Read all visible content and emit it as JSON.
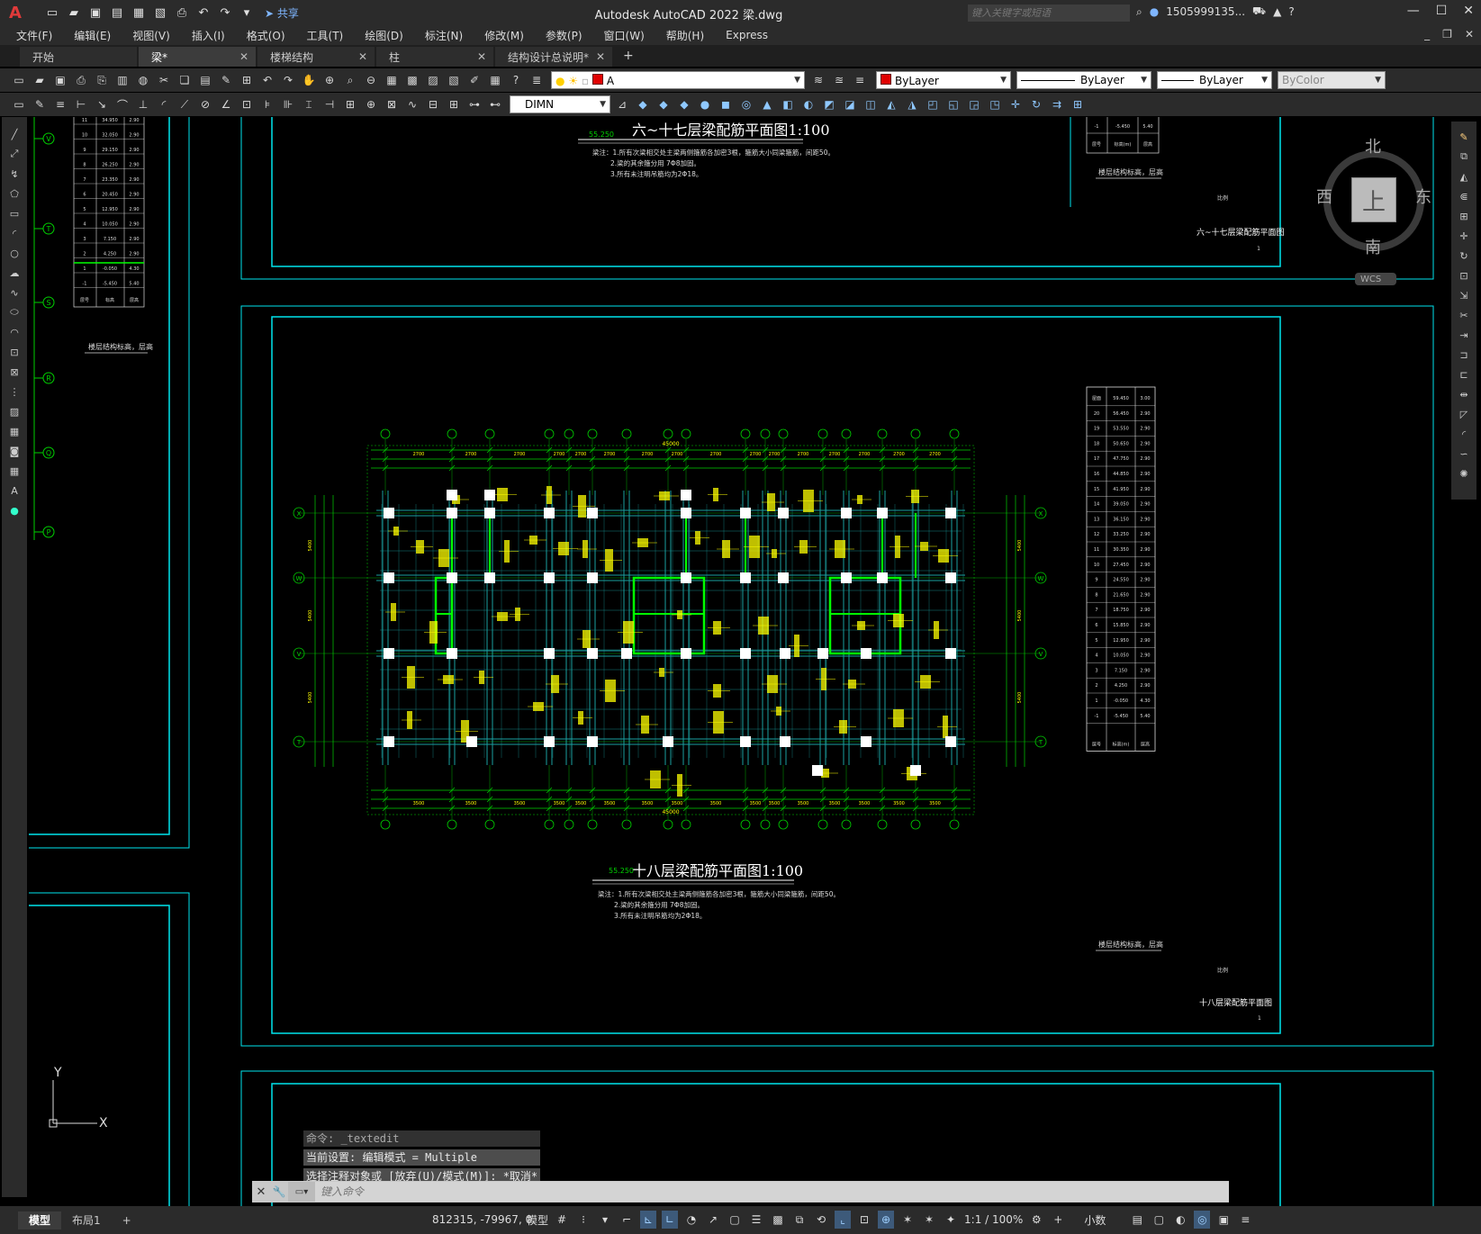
{
  "app": {
    "title": "Autodesk AutoCAD 2022    梁.dwg",
    "logo": "A",
    "share_label": "共享",
    "search_placeholder": "键入关键字或短语",
    "user": "1505999135...",
    "window_controls": [
      "—",
      "☐",
      "✕"
    ]
  },
  "menu": [
    "文件(F)",
    "编辑(E)",
    "视图(V)",
    "插入(I)",
    "格式(O)",
    "工具(T)",
    "绘图(D)",
    "标注(N)",
    "修改(M)",
    "参数(P)",
    "窗口(W)",
    "帮助(H)",
    "Express"
  ],
  "tabs": [
    {
      "label": "开始",
      "closable": false,
      "active": false
    },
    {
      "label": "梁*",
      "closable": true,
      "active": true
    },
    {
      "label": "楼梯结构",
      "closable": true,
      "active": false
    },
    {
      "label": "柱",
      "closable": true,
      "active": false
    },
    {
      "label": "结构设计总说明*",
      "closable": true,
      "active": false
    }
  ],
  "properties": {
    "layer": "A",
    "color": "ByLayer",
    "linetype": "ByLayer",
    "lineweight": "ByLayer",
    "plotstyle": "ByColor",
    "dimstyle": "DIMN",
    "layer_color": "#e00000"
  },
  "viewcube": {
    "north": "北",
    "south": "南",
    "west": "西",
    "east": "东",
    "top": "上",
    "wcs": "WCS"
  },
  "drawing": {
    "upper_title": "六~十七层梁配筋平面图1:100",
    "upper_elev": "55.250",
    "main_title": "十八层梁配筋平面图1:100",
    "main_elev": "55.250",
    "notes": [
      "梁注：1.所有次梁相交处主梁两侧箍筋各加密3根，箍筋大小同梁箍筋，间距50。",
      "2.梁的其余箍分用 7Φ8加固。",
      "3.所有未注明吊筋均为2Φ18。"
    ],
    "table_caption": "楼层结构标高，层高",
    "right_label_upper": "六~十七层梁配筋平面图",
    "right_label_main": "十八层梁配筋平面图",
    "scale_label": "比例",
    "sheet_no": "1",
    "total_dim": "45000",
    "axis_rows": [
      "X",
      "W",
      "V",
      "T"
    ],
    "left_axis_rows": [
      "V",
      "T",
      "S",
      "R",
      "Q",
      "P"
    ],
    "floor_table_header": [
      "层号",
      "标高(m)",
      "层高"
    ],
    "floor_table": [
      [
        "屋面",
        "59.450",
        "3.00"
      ],
      [
        "20",
        "56.450",
        "2.90"
      ],
      [
        "19",
        "53.550",
        "2.90"
      ],
      [
        "18",
        "50.650",
        "2.90"
      ],
      [
        "17",
        "47.750",
        "2.90"
      ],
      [
        "16",
        "44.850",
        "2.90"
      ],
      [
        "15",
        "41.950",
        "2.90"
      ],
      [
        "14",
        "39.050",
        "2.90"
      ],
      [
        "13",
        "36.150",
        "2.90"
      ],
      [
        "12",
        "33.250",
        "2.90"
      ],
      [
        "11",
        "30.350",
        "2.90"
      ],
      [
        "10",
        "27.450",
        "2.90"
      ],
      [
        "9",
        "24.550",
        "2.90"
      ],
      [
        "8",
        "21.650",
        "2.90"
      ],
      [
        "7",
        "18.750",
        "2.90"
      ],
      [
        "6",
        "15.850",
        "2.90"
      ],
      [
        "5",
        "12.950",
        "2.90"
      ],
      [
        "4",
        "10.050",
        "2.90"
      ],
      [
        "3",
        "7.150",
        "2.90"
      ],
      [
        "2",
        "4.250",
        "2.90"
      ],
      [
        "1",
        "-0.050",
        "4.30"
      ],
      [
        "-1",
        "-5.450",
        "5.40"
      ]
    ],
    "left_table": [
      [
        "11",
        "34.950",
        "2.90"
      ],
      [
        "10",
        "32.050",
        "2.90"
      ],
      [
        "9",
        "29.150",
        "2.90"
      ],
      [
        "8",
        "26.250",
        "2.90"
      ],
      [
        "7",
        "23.350",
        "2.90"
      ],
      [
        "6",
        "20.450",
        "2.90"
      ],
      [
        "5",
        "12.950",
        "2.90"
      ],
      [
        "4",
        "10.050",
        "2.90"
      ],
      [
        "3",
        "7.150",
        "2.90"
      ],
      [
        "2",
        "4.250",
        "2.90"
      ],
      [
        "1",
        "-0.050",
        "4.30"
      ],
      [
        "-1",
        "-5.450",
        "5.40"
      ]
    ],
    "left_table_footer": [
      "层号",
      "标高",
      "层高"
    ],
    "ucs": {
      "x": "X",
      "y": "Y"
    }
  },
  "command": {
    "history": [
      "命令: _textedit",
      "当前设置: 编辑模式 = Multiple",
      "选择注释对象或 [放弃(U)/模式(M)]: *取消*"
    ],
    "placeholder": "键入命令"
  },
  "status": {
    "layouts": [
      "模型",
      "布局1"
    ],
    "coords": "812315, -79967, 0",
    "model_label": "模型",
    "scale": "1:1 / 100%",
    "units": "小数"
  },
  "colors": {
    "frame": "#00e5ee",
    "axis": "#00d000",
    "beam": "#00ff00",
    "column": "#ffffff",
    "wall": "#1aa0a0",
    "annotation": "#ffff00",
    "bg": "#000000"
  }
}
